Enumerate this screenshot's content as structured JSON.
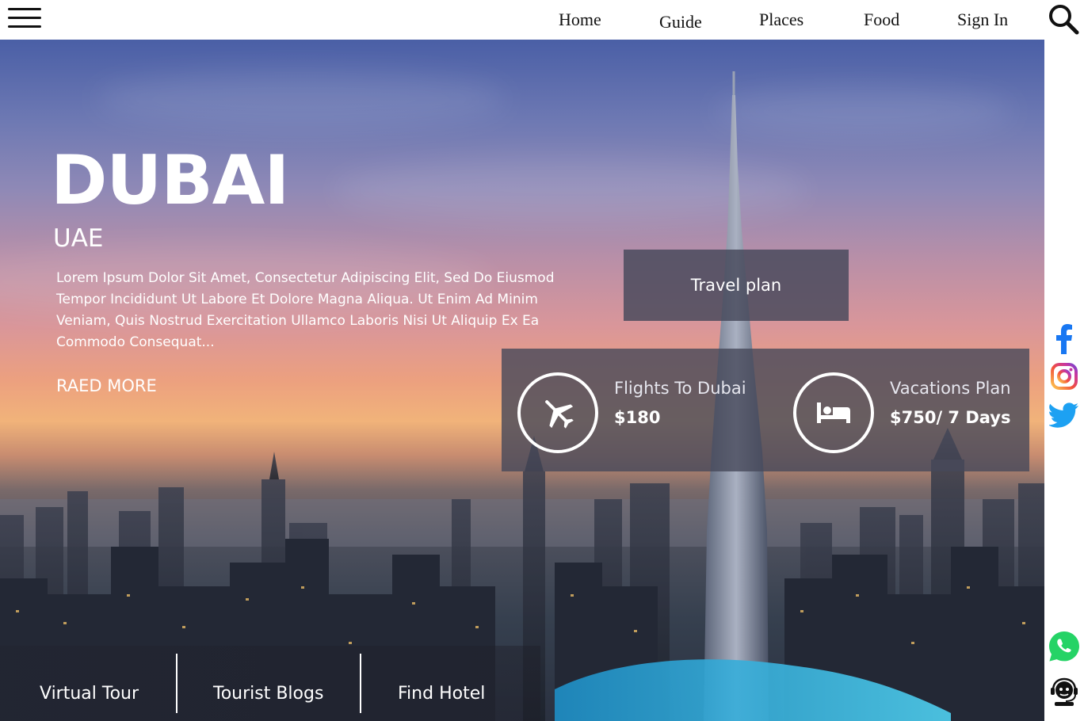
{
  "nav": {
    "links": [
      "Home",
      "Guide",
      "Places",
      "Food",
      "Sign In"
    ]
  },
  "hero": {
    "title": "DUBAI",
    "subtitle": "UAE",
    "description": "Lorem Ipsum Dolor Sit Amet, Consectetur Adipiscing Elit, Sed Do Eiusmod Tempor Incididunt Ut Labore Et Dolore Magna Aliqua. Ut Enim Ad Minim Veniam, Quis Nostrud Exercitation Ullamco Laboris Nisi Ut Aliquip Ex Ea Commodo Consequat...",
    "read_more": "RAED MORE",
    "travel_plan_label": "Travel plan"
  },
  "deals": [
    {
      "name": "Flights To Dubai",
      "price": "$180",
      "icon": "airplane-icon"
    },
    {
      "name": "Vacations Plan",
      "price": "$750/ 7 Days",
      "icon": "bed-icon"
    }
  ],
  "bottom_links": [
    "Virtual Tour",
    "Tourist Blogs",
    "Find Hotel"
  ],
  "social": [
    "facebook-icon",
    "instagram-icon",
    "twitter-icon",
    "whatsapp-icon",
    "support-agent-icon"
  ],
  "colors": {
    "facebook": "#1877f2",
    "twitter": "#1da1f2",
    "whatsapp": "#25d366",
    "panel": "#46485a"
  }
}
